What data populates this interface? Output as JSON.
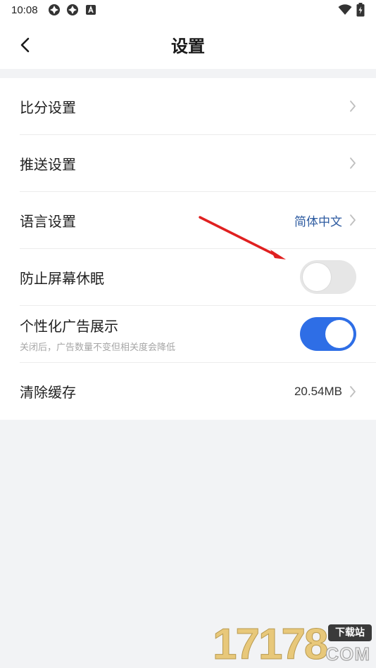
{
  "status_bar": {
    "time": "10:08",
    "icons": [
      "app-notification-icon",
      "app-notification-icon",
      "a-badge-icon",
      "wifi-icon",
      "battery-icon"
    ]
  },
  "header": {
    "title": "设置",
    "back_icon": "back-chevron-icon"
  },
  "settings": {
    "score": {
      "label": "比分设置"
    },
    "push": {
      "label": "推送设置"
    },
    "language": {
      "label": "语言设置",
      "value": "简体中文"
    },
    "keep_awake": {
      "label": "防止屏幕休眠",
      "enabled": false
    },
    "personalized_ads": {
      "label": "个性化广告展示",
      "hint": "关闭后，广告数量不变但相关度会降低",
      "enabled": true
    },
    "clear_cache": {
      "label": "清除缓存",
      "value": "20.54MB"
    }
  },
  "watermark": {
    "digits": "17178",
    "badge": "下载站",
    "domain": "COM"
  },
  "colors": {
    "accent": "#2e6ee6",
    "link_blue": "#2c5aa0",
    "annotation_red": "#e02020",
    "background": "#f2f3f5"
  }
}
